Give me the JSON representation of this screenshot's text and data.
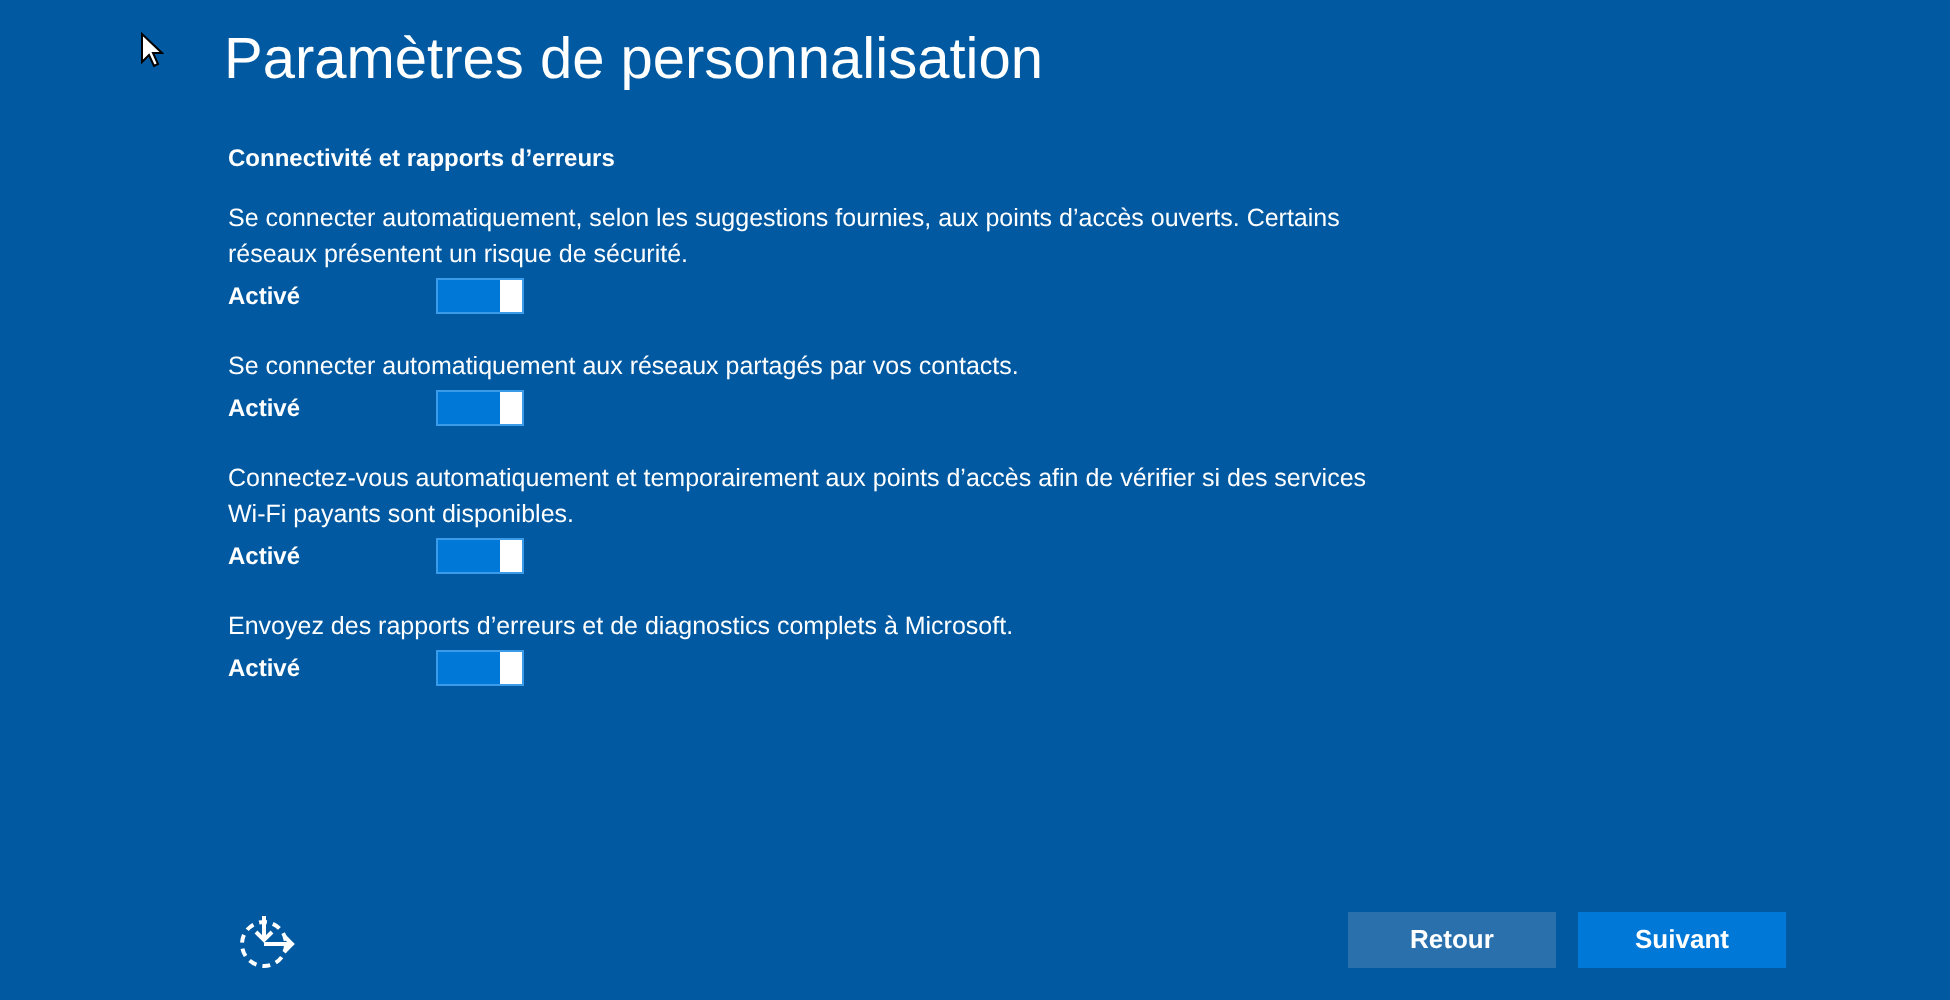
{
  "title": "Paramètres de personnalisation",
  "section": {
    "heading": "Connectivité et rapports d’erreurs",
    "settings": [
      {
        "description": "Se connecter automatiquement, selon les suggestions fournies, aux points d’accès ouverts. Certains réseaux présentent un risque de sécurité.",
        "state_label": "Activé",
        "on": true
      },
      {
        "description": "Se connecter automatiquement aux réseaux partagés par vos contacts.",
        "state_label": "Activé",
        "on": true
      },
      {
        "description": "Connectez-vous automatiquement et temporairement aux points d’accès afin de vérifier si des services Wi-Fi payants sont disponibles.",
        "state_label": "Activé",
        "on": true
      },
      {
        "description": "Envoyez des rapports d’erreurs et de diagnostics complets à Microsoft.",
        "state_label": "Activé",
        "on": true
      }
    ]
  },
  "buttons": [
    {
      "label": "Retour",
      "kind": "secondary"
    },
    {
      "label": "Suivant",
      "kind": "primary"
    }
  ]
}
